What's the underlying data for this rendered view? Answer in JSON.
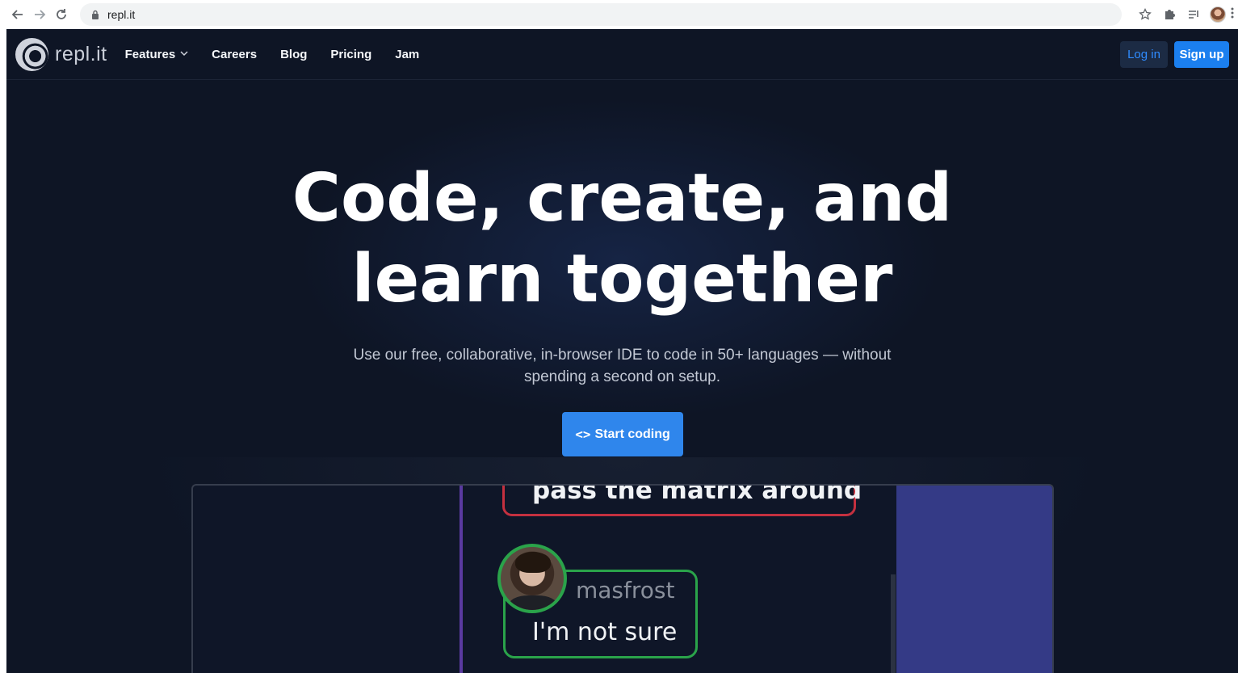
{
  "browser": {
    "url": "repl.it"
  },
  "nav": {
    "logo_text": "repl.it",
    "menu": [
      {
        "label": "Features"
      },
      {
        "label": "Careers"
      },
      {
        "label": "Blog"
      },
      {
        "label": "Pricing"
      },
      {
        "label": "Jam"
      }
    ],
    "login_label": "Log in",
    "signup_label": "Sign up"
  },
  "hero": {
    "title_line1": "Code, create, and",
    "title_line2": "learn together",
    "subtitle_line1": "Use our free, collaborative, in-browser IDE to code in 50+ languages — without",
    "subtitle_line2": "spending a second on setup.",
    "cta_icon": "<>",
    "cta_label": "Start coding"
  },
  "preview": {
    "top_bubble_text": "pass the matrix around",
    "username": "masfrost",
    "message": "I'm not sure"
  },
  "colors": {
    "page_bg": "#0e1525",
    "accent_blue": "#1b7fef",
    "cta_blue": "#2f86ec",
    "bubble_red": "#c4303f",
    "bubble_green": "#2aa34a",
    "panel_indigo": "#343a86"
  },
  "icons": {
    "back": "arrow-left-icon",
    "forward": "arrow-right-icon",
    "reload": "reload-icon",
    "lock": "lock-icon",
    "bookmark": "star-icon",
    "extensions": "puzzle-icon",
    "media": "playlist-icon",
    "profile": "avatar-icon",
    "menu": "kebab-menu-icon",
    "features_dropdown": "chevron-down-icon"
  }
}
